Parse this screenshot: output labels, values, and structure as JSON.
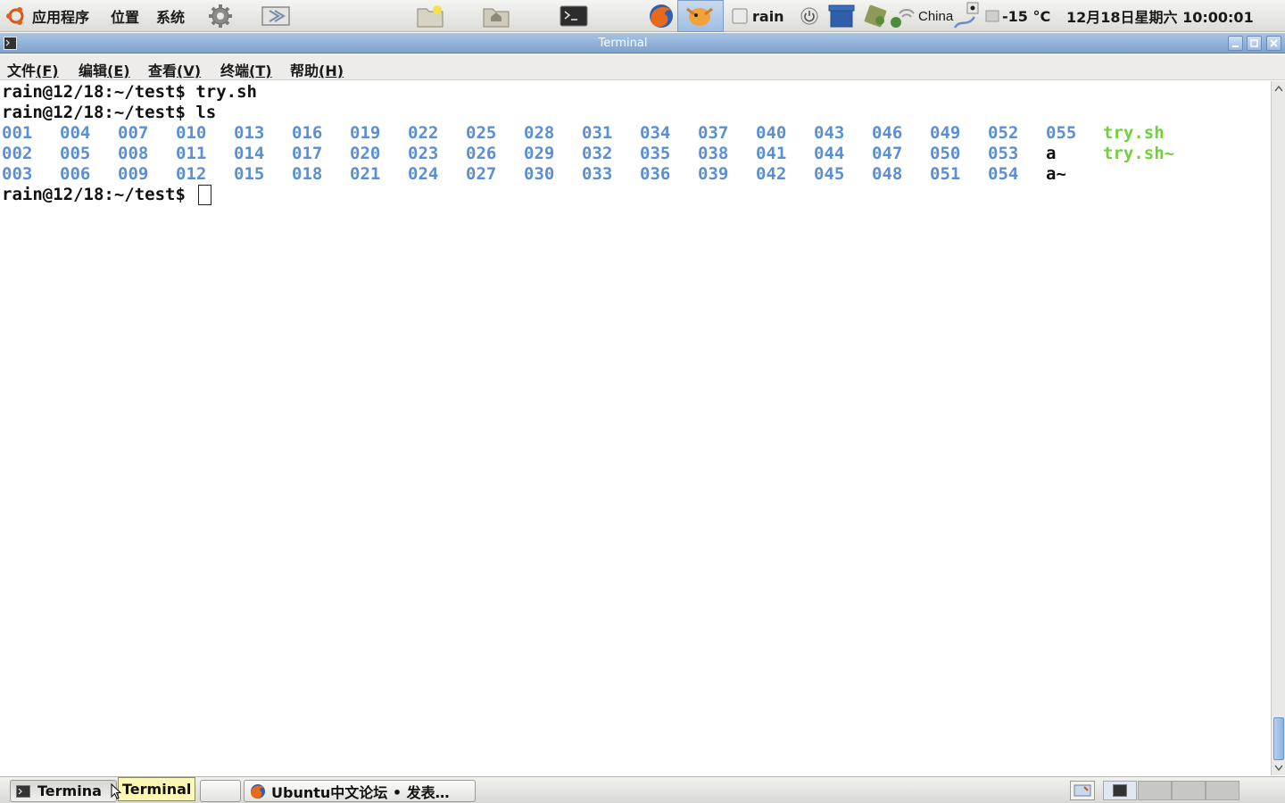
{
  "top_panel": {
    "menus": [
      "应用程序",
      "位置",
      "系统"
    ],
    "user": "rain",
    "weather": "-15 °C",
    "clock": "12月18日星期六 10:00:01",
    "keyboard_layout": "China"
  },
  "window": {
    "title": "Terminal"
  },
  "menubar": {
    "items": [
      {
        "label": "文件",
        "mnemonic": "(F)"
      },
      {
        "label": "编辑",
        "mnemonic": "(E)"
      },
      {
        "label": "查看",
        "mnemonic": "(V)"
      },
      {
        "label": "终端",
        "mnemonic": "(T)"
      },
      {
        "label": "帮助",
        "mnemonic": "(H)"
      }
    ]
  },
  "terminal": {
    "lines": [
      "rain@12/18:~/test$ try.sh",
      "rain@12/18:~/test$ ls"
    ],
    "prompt": "rain@12/18:~/test$ ",
    "ls_columns": [
      [
        "001",
        "002",
        "003"
      ],
      [
        "004",
        "005",
        "006"
      ],
      [
        "007",
        "008",
        "009"
      ],
      [
        "010",
        "011",
        "012"
      ],
      [
        "013",
        "014",
        "015"
      ],
      [
        "016",
        "017",
        "018"
      ],
      [
        "019",
        "020",
        "021"
      ],
      [
        "022",
        "023",
        "024"
      ],
      [
        "025",
        "026",
        "027"
      ],
      [
        "028",
        "029",
        "030"
      ],
      [
        "031",
        "032",
        "033"
      ],
      [
        "034",
        "035",
        "036"
      ],
      [
        "037",
        "038",
        "039"
      ],
      [
        "040",
        "041",
        "042"
      ],
      [
        "043",
        "044",
        "045"
      ],
      [
        "046",
        "047",
        "048"
      ],
      [
        "049",
        "050",
        "051"
      ],
      [
        "052",
        "053",
        "054"
      ],
      [
        "055",
        "a",
        "a~"
      ],
      [
        "try.sh",
        "try.sh~"
      ]
    ],
    "colors": {
      "directory": "#5b8fd4",
      "executable": "#6fd23a",
      "regular": "#111111"
    }
  },
  "taskbar": {
    "tasks": [
      {
        "label": "Termina",
        "icon": "terminal-icon",
        "active": true
      },
      {
        "label": "",
        "icon": "",
        "active": false
      },
      {
        "label": "Ubuntu中文论坛 • 发表…",
        "icon": "firefox-icon",
        "active": false
      }
    ],
    "tooltip": "Terminal"
  }
}
